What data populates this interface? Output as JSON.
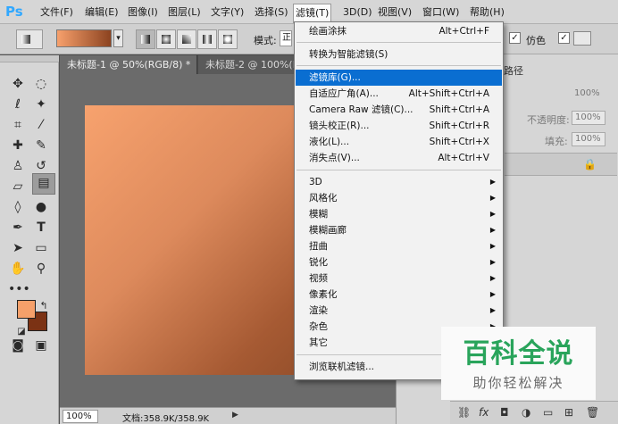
{
  "app": {
    "logo": "Ps"
  },
  "menubar": {
    "items": [
      "文件(F)",
      "编辑(E)",
      "图像(I)",
      "图层(L)",
      "文字(Y)",
      "选择(S)",
      "滤镜(T)",
      "3D(D)",
      "视图(V)",
      "窗口(W)",
      "帮助(H)"
    ],
    "active_index": 6
  },
  "options": {
    "mode_label": "模式:",
    "mode_value": "正",
    "dither_checked": true,
    "dither_label": "仿色",
    "transparency_checked": true
  },
  "tabs": [
    {
      "label": "未标题-1 @ 50%(RGB/8) *",
      "close": "×"
    },
    {
      "label": "未标题-2 @ 100%(R",
      "close": ""
    }
  ],
  "status": {
    "zoom": "100%",
    "doc_info": "文档:358.9K/358.9K",
    "arrow": "▶"
  },
  "panels": {
    "tab_label": "路径",
    "opacity_label": "不透明度:",
    "opacity_value": "100%",
    "fill_label": "填充:",
    "fill_value": "100%",
    "kind_value": "100%"
  },
  "filter_menu": {
    "groups": [
      [
        {
          "label": "绘画涂抹",
          "shortcut": "Alt+Ctrl+F"
        }
      ],
      [
        {
          "label": "转换为智能滤镜(S)",
          "shortcut": ""
        }
      ],
      [
        {
          "label": "滤镜库(G)...",
          "shortcut": "",
          "highlighted": true
        },
        {
          "label": "自适应广角(A)...",
          "shortcut": "Alt+Shift+Ctrl+A"
        },
        {
          "label": "Camera Raw 滤镜(C)...",
          "shortcut": "Shift+Ctrl+A"
        },
        {
          "label": "镜头校正(R)...",
          "shortcut": "Shift+Ctrl+R"
        },
        {
          "label": "液化(L)...",
          "shortcut": "Shift+Ctrl+X"
        },
        {
          "label": "消失点(V)...",
          "shortcut": "Alt+Ctrl+V"
        }
      ],
      [
        {
          "label": "3D",
          "submenu": true
        },
        {
          "label": "风格化",
          "submenu": true
        },
        {
          "label": "模糊",
          "submenu": true
        },
        {
          "label": "模糊画廊",
          "submenu": true
        },
        {
          "label": "扭曲",
          "submenu": true
        },
        {
          "label": "锐化",
          "submenu": true
        },
        {
          "label": "视频",
          "submenu": true
        },
        {
          "label": "像素化",
          "submenu": true
        },
        {
          "label": "渲染",
          "submenu": true
        },
        {
          "label": "杂色",
          "submenu": true
        },
        {
          "label": "其它",
          "submenu": true
        }
      ],
      [
        {
          "label": "浏览联机滤镜...",
          "shortcut": ""
        }
      ]
    ]
  },
  "watermark": {
    "title": "百科全说",
    "subtitle": "助你轻松解决"
  },
  "colors": {
    "foreground": "#f6a06a",
    "background": "#7b3214",
    "highlight": "#0a6ed1",
    "watermark_green": "#29a45b"
  }
}
